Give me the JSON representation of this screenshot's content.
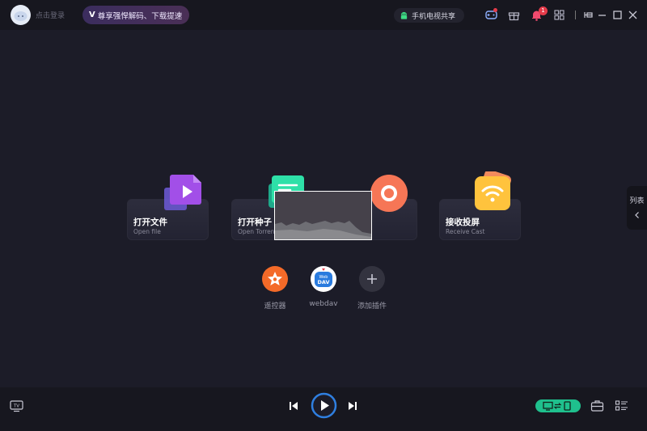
{
  "header": {
    "login_text": "点击登录",
    "promo_mark": "V",
    "promo_text": "尊享强悍解码、下载提速",
    "mobile_share": "手机电视共享",
    "notification_count": "1"
  },
  "cards": [
    {
      "title": "打开文件",
      "subtitle": "Open file"
    },
    {
      "title": "打开种子",
      "subtitle": "Open Torrent"
    },
    {
      "title": "",
      "subtitle": ""
    },
    {
      "title": "接收投屏",
      "subtitle": "Receive Cast"
    }
  ],
  "plugins": [
    {
      "label": "遥控器"
    },
    {
      "label": "webdav"
    },
    {
      "label": "添加插件"
    }
  ],
  "side_tab": {
    "label": "列表"
  },
  "colors": {
    "background": "#1c1c28",
    "bar": "#17171f",
    "accent_green": "#1fc08d",
    "play_ring": "#2f7fe0",
    "badge_red": "#e53b4a"
  }
}
